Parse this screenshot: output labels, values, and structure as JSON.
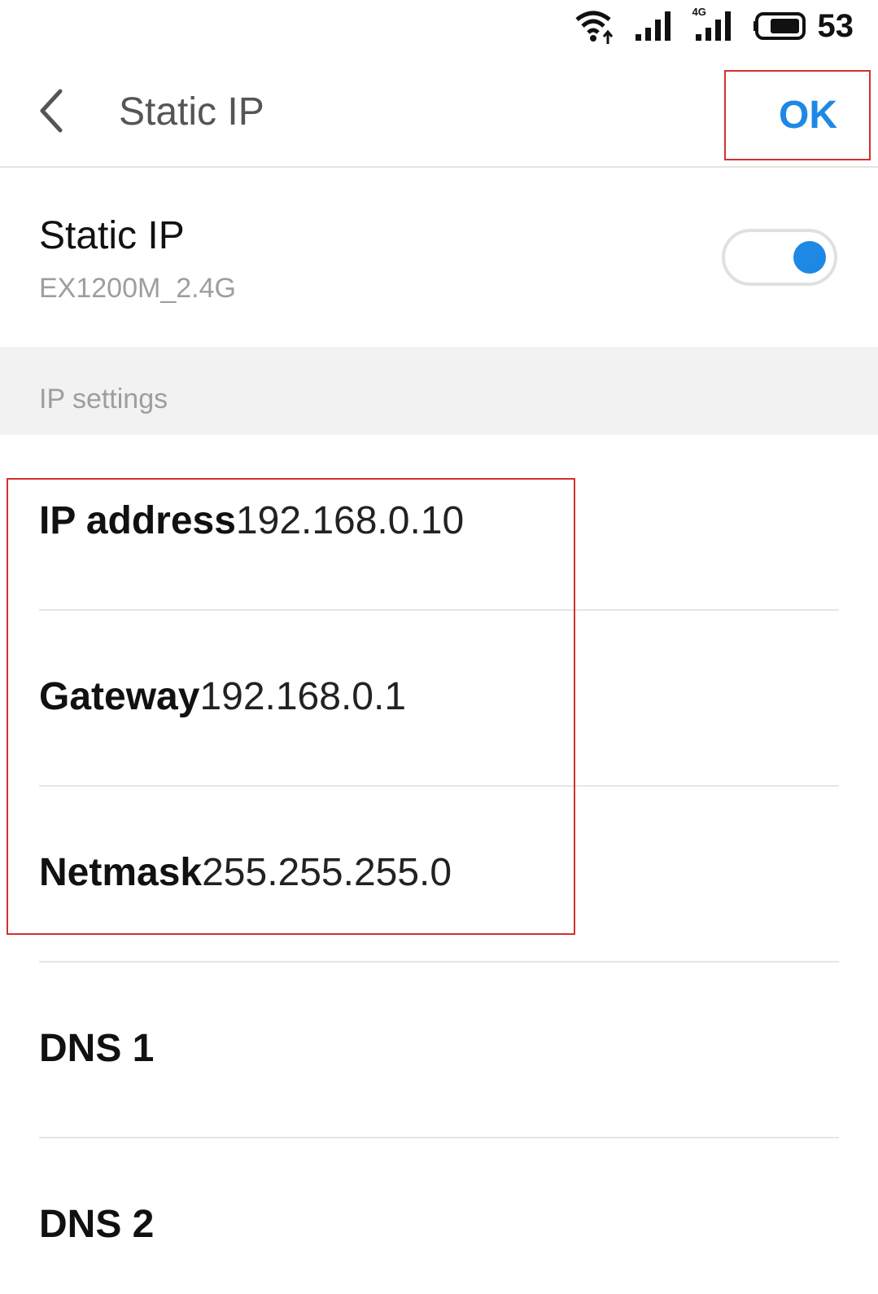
{
  "status_bar": {
    "icons": [
      "wifi-icon",
      "signal-icon",
      "4g-signal-icon",
      "battery-icon"
    ],
    "network_label": "4G",
    "battery": "53"
  },
  "appbar": {
    "back_icon": "chevron-left-icon",
    "title": "Static IP",
    "ok_label": "OK"
  },
  "static_ip": {
    "title": "Static IP",
    "ssid": "EX1200M_2.4G",
    "enabled": true
  },
  "section": {
    "title": "IP settings"
  },
  "fields": [
    {
      "label": "IP address",
      "value": "192.168.0.10"
    },
    {
      "label": "Gateway",
      "value": "192.168.0.1"
    },
    {
      "label": "Netmask",
      "value": "255.255.255.0"
    },
    {
      "label": "DNS 1",
      "value": ""
    },
    {
      "label": "DNS 2",
      "value": ""
    }
  ],
  "colors": {
    "accent": "#1e88e5",
    "highlight": "#d32f2f",
    "text_primary": "#111111",
    "text_secondary": "#9e9e9e"
  }
}
